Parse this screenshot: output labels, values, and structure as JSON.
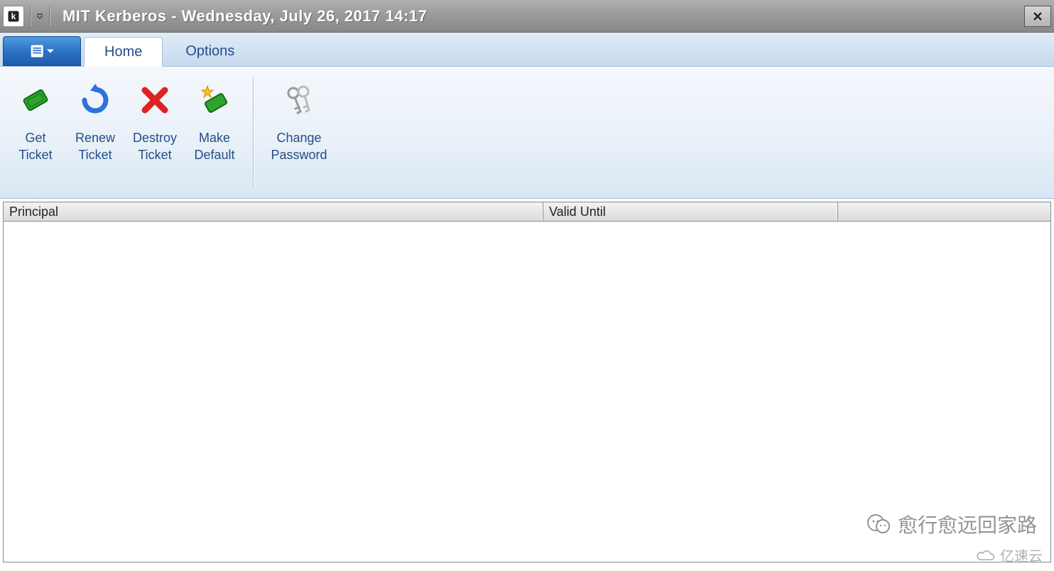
{
  "window": {
    "title": "MIT Kerberos - Wednesday, July 26, 2017  14:17"
  },
  "tabs": {
    "home": "Home",
    "options": "Options"
  },
  "ribbon": {
    "get_ticket": "Get\nTicket",
    "renew_ticket": "Renew\nTicket",
    "destroy_ticket": "Destroy\nTicket",
    "make_default": "Make\nDefault",
    "change_password": "Change\nPassword"
  },
  "table": {
    "columns": [
      "Principal",
      "Valid Until",
      ""
    ],
    "rows": []
  },
  "watermarks": {
    "line1": "愈行愈远回家路",
    "line2": "亿速云"
  }
}
